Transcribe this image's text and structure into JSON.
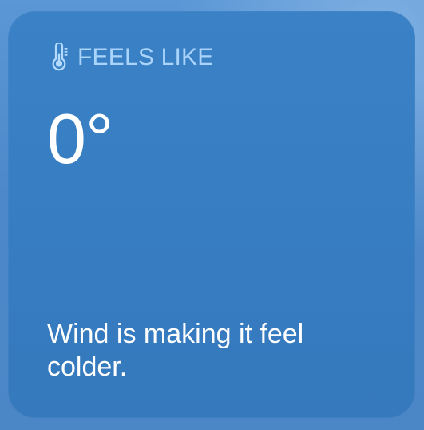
{
  "widget": {
    "icon": "thermometer-icon",
    "title": "FEELS LIKE",
    "temperature": "0°",
    "description": "Wind is making it feel colder."
  },
  "colors": {
    "background": "#4a86c6",
    "card": "#377dc1",
    "title": "#b4dbff",
    "text": "#ffffff"
  }
}
